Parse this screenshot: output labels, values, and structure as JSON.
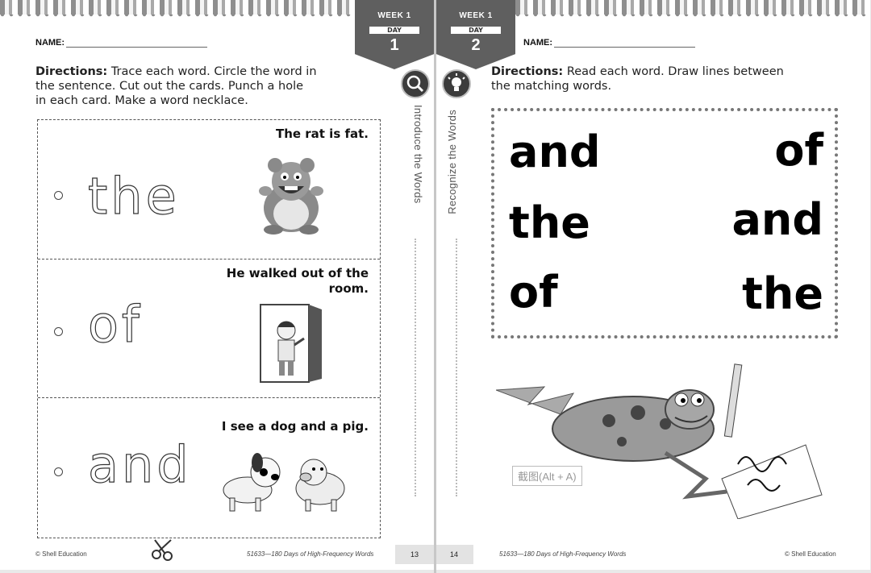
{
  "left_page": {
    "tab": {
      "week": "WEEK 1",
      "day_label": "DAY",
      "day_number": "1"
    },
    "name_label": "NAME:",
    "directions_lead": "Directions:",
    "directions_lines": [
      "Trace each word.  Circle the word in",
      "the sentence.  Cut out the cards.  Punch a hole",
      "in each card.  Make a word necklace."
    ],
    "side_label": "Introduce the Words",
    "cards": [
      {
        "trace_word": "the",
        "sentence": "The rat is fat.",
        "picture": "rat-illustration"
      },
      {
        "trace_word": "of",
        "sentence": "He walked out of the room.",
        "picture": "boy-door-illustration"
      },
      {
        "trace_word": "and",
        "sentence": "I see a dog and a pig.",
        "picture": "dog-pig-illustration"
      }
    ],
    "footer_left": "© Shell Education",
    "footer_center": "51633—180 Days of High-Frequency Words",
    "page_number": "13"
  },
  "right_page": {
    "tab": {
      "week": "WEEK 1",
      "day_label": "DAY",
      "day_number": "2"
    },
    "name_label": "NAME:",
    "directions_lead": "Directions:",
    "directions_lines": [
      "Read each word.  Draw lines between",
      "the matching words."
    ],
    "side_label": "Recognize the Words",
    "left_words": [
      "and",
      "the",
      "of"
    ],
    "right_words": [
      "of",
      "and",
      "the"
    ],
    "footer_center": "51633—180 Days of High-Frequency Words",
    "footer_right": "© Shell Education",
    "page_number": "14",
    "overlay_label": "截图(Alt + A)"
  }
}
